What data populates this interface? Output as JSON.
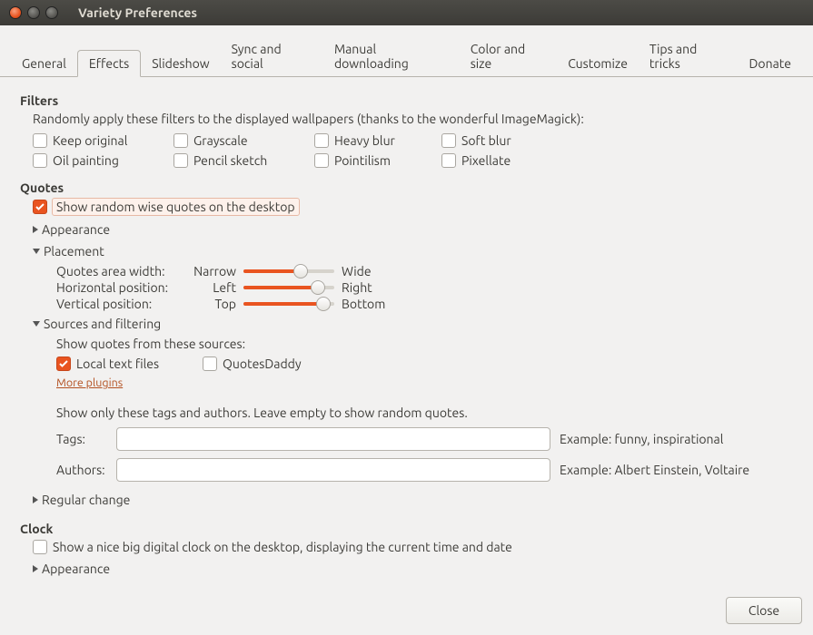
{
  "window": {
    "title": "Variety Preferences"
  },
  "tabs": [
    "General",
    "Effects",
    "Slideshow",
    "Sync and social",
    "Manual downloading",
    "Color and size",
    "Customize",
    "Tips and tricks",
    "Donate"
  ],
  "active_tab": 1,
  "filters": {
    "heading": "Filters",
    "description": "Randomly apply these filters to the displayed wallpapers (thanks to the wonderful ImageMagick):",
    "items": [
      {
        "label": "Keep original",
        "checked": false
      },
      {
        "label": "Grayscale",
        "checked": false
      },
      {
        "label": "Heavy blur",
        "checked": false
      },
      {
        "label": "Soft blur",
        "checked": false
      },
      {
        "label": "Oil painting",
        "checked": false
      },
      {
        "label": "Pencil sketch",
        "checked": false
      },
      {
        "label": "Pointilism",
        "checked": false
      },
      {
        "label": "Pixellate",
        "checked": false
      }
    ]
  },
  "quotes": {
    "heading": "Quotes",
    "show_random": {
      "label": "Show random wise quotes on the desktop",
      "checked": true
    },
    "appearance": {
      "label": "Appearance",
      "expanded": false
    },
    "placement": {
      "label": "Placement",
      "expanded": true,
      "rows": [
        {
          "name": "Quotes area width:",
          "left": "Narrow",
          "right": "Wide",
          "value": 63
        },
        {
          "name": "Horizontal position:",
          "left": "Left",
          "right": "Right",
          "value": 82
        },
        {
          "name": "Vertical position:",
          "left": "Top",
          "right": "Bottom",
          "value": 88
        }
      ]
    },
    "sources": {
      "label": "Sources and filtering",
      "expanded": true,
      "intro": "Show quotes from these sources:",
      "items": [
        {
          "label": "Local text files",
          "checked": true
        },
        {
          "label": "QuotesDaddy",
          "checked": false
        }
      ],
      "more": "More plugins",
      "filter_intro": "Show only these tags and authors. Leave empty to show random quotes.",
      "tags": {
        "label": "Tags:",
        "value": "",
        "hint": "Example: funny, inspirational"
      },
      "authors": {
        "label": "Authors:",
        "value": "",
        "hint": "Example: Albert Einstein, Voltaire"
      }
    },
    "regular_change": {
      "label": "Regular change",
      "expanded": false
    }
  },
  "clock": {
    "heading": "Clock",
    "show": {
      "label": "Show a nice big digital clock on the desktop, displaying the current time and date",
      "checked": false
    },
    "appearance": {
      "label": "Appearance",
      "expanded": false
    }
  },
  "footer": {
    "close": "Close"
  }
}
